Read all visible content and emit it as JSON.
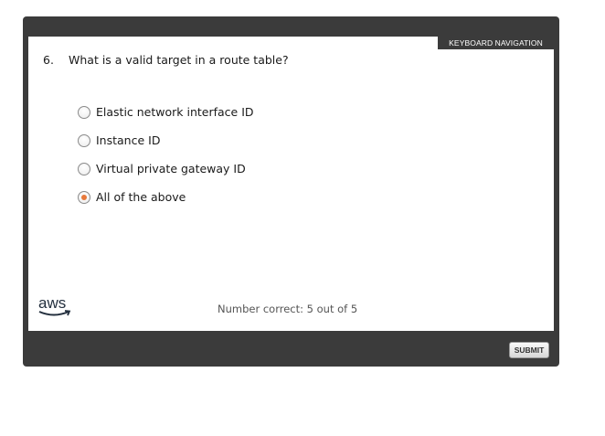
{
  "header": {
    "keyboard_nav_label": "KEYBOARD NAVIGATION"
  },
  "question": {
    "number": "6.",
    "text": "What is a valid target in a route table?"
  },
  "options": [
    {
      "label": "Elastic network interface ID",
      "selected": false
    },
    {
      "label": "Instance ID",
      "selected": false
    },
    {
      "label": "Virtual private gateway ID",
      "selected": false
    },
    {
      "label": "All of the above",
      "selected": true
    }
  ],
  "footer": {
    "logo_text": "aws",
    "score_text": "Number correct: 5 out of 5"
  },
  "controls": {
    "submit_label": "SUBMIT"
  },
  "colors": {
    "player_frame": "#3b3b3b",
    "radio_selected": "#e8793b",
    "aws_smile": "#232f3e"
  }
}
